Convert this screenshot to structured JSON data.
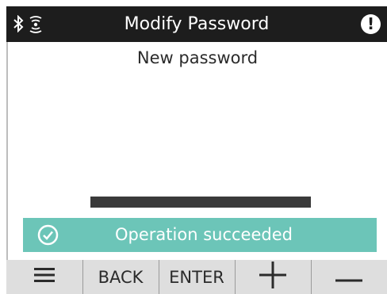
{
  "header": {
    "title": "Modify Password",
    "icons": [
      "bluetooth-icon",
      "wireless-signal-icon",
      "alert-icon"
    ],
    "alert_symbol": "!"
  },
  "content": {
    "label": "New password"
  },
  "toast": {
    "message": "Operation succeeded",
    "icon": "check-circle-icon",
    "color": "#6cc5b8"
  },
  "softkeys": [
    {
      "label": "",
      "icon": "menu-icon"
    },
    {
      "label": "BACK"
    },
    {
      "label": "ENTER"
    },
    {
      "label": "",
      "icon": "plus-icon"
    },
    {
      "label": "",
      "icon": "minus-icon"
    }
  ],
  "colors": {
    "header_bg": "#1d1d1d",
    "softkey_bg": "#dedede",
    "toast_bg": "#6cc5b8"
  }
}
